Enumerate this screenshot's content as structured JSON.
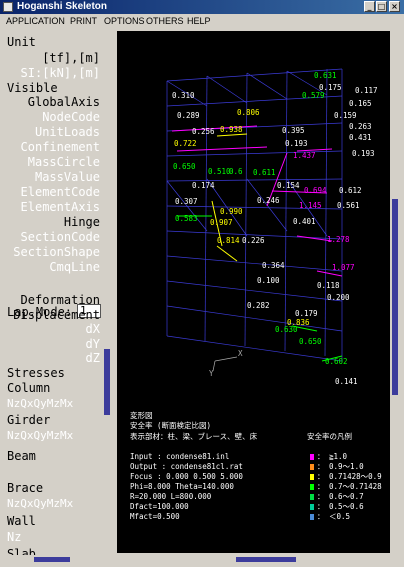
{
  "window": {
    "title": "Hoganshi Skeleton"
  },
  "menu": [
    "APPLICATION",
    "PRINT",
    "OPTIONS",
    "OTHERS",
    "HELP"
  ],
  "panel": {
    "unit_label": "Unit",
    "unit_tf": "[tf],[m]",
    "unit_si": "SI:[kN],[m]",
    "visible_label": "Visible",
    "global_axis": "GlobalAxis",
    "node_code": "NodeCode",
    "unit_loads": "UnitLoads",
    "confinement": "Confinement",
    "mass_circle": "MassCircle",
    "mass_value": "MassValue",
    "element_code": "ElementCode",
    "element_axis": "ElementAxis",
    "hinge": "Hinge",
    "section_code": "SectionCode",
    "section_shape": "SectionShape",
    "cmq_line": "CmqLine",
    "lap_mode_label": "Lap.Mode:",
    "lap_mode_value": "1",
    "deformation": "Deformation",
    "displacement": "Displacement",
    "dx": "dX",
    "dy": "dY",
    "dz": "dZ",
    "stresses": "Stresses",
    "column": "Column",
    "column_forces": "NzQxQyMzMx",
    "girder": "Girder",
    "girder_forces": "NzQxQyMzMx",
    "beam": "Beam",
    "brace": "Brace",
    "brace_forces": "NzQxQyMzMx",
    "wall": "Wall",
    "wall_forces": "Nz",
    "slab_partial": "Slab"
  },
  "view": {
    "values": [
      "0.631",
      "0.117",
      "0.579",
      "0.165",
      "0.806",
      "0.938",
      "0.159",
      "0.263",
      "0.722",
      "0.193",
      "0.193",
      "1.437",
      "0.650",
      "0.510",
      "0.6",
      "0.611",
      "0.154",
      "0.694",
      "0.612",
      "0.990",
      "1.145",
      "0.561",
      "0.907",
      "0.401",
      "0.583",
      "0.814",
      "0.836",
      "0.630",
      "0.650",
      "0.602",
      "0.141",
      "0.179",
      "1.278",
      "1.077",
      "0.256",
      "0.431",
      "0.395",
      "0.246",
      "0.307",
      "0.174",
      "0.118",
      "0.100",
      "0.200",
      "0.282",
      "0.175",
      "0.310",
      "0.289",
      "0.364",
      "0.226"
    ],
    "axis_x": "X",
    "axis_y": "Y",
    "mode_lines": [
      "変形図",
      "安全率 (断面検定比図)",
      "表示部材：柱、梁、ブレース、壁、床"
    ],
    "input_line": "Input  : condense81.inl",
    "output_line": "Output : condense81cl.rat",
    "focus_line": "Focus : 0.000 0.500 5.000",
    "phi_line": "Phi=8.000 Theta=140.000",
    "r_line": "R=20.000 L=800.000",
    "dfact_line": "Dfact=100.000",
    "mfact_line": "Mfact=0.500",
    "legend_title": "安全率の凡例",
    "legend": [
      {
        "label": "： ≧1.0",
        "color": "#ff00ff"
      },
      {
        "label": "： 0.9～1.0",
        "color": "#ff8c1a"
      },
      {
        "label": "： 0.71428～0.9",
        "color": "#ffff00"
      },
      {
        "label": "： 0.7～0.71428",
        "color": "#00ff00"
      },
      {
        "label": "： 0.6～0.7",
        "color": "#00dd44"
      },
      {
        "label": "： 0.5～0.6",
        "color": "#00cc99"
      },
      {
        "label": "： ＜0.5",
        "color": "#4b8bd6"
      }
    ]
  }
}
